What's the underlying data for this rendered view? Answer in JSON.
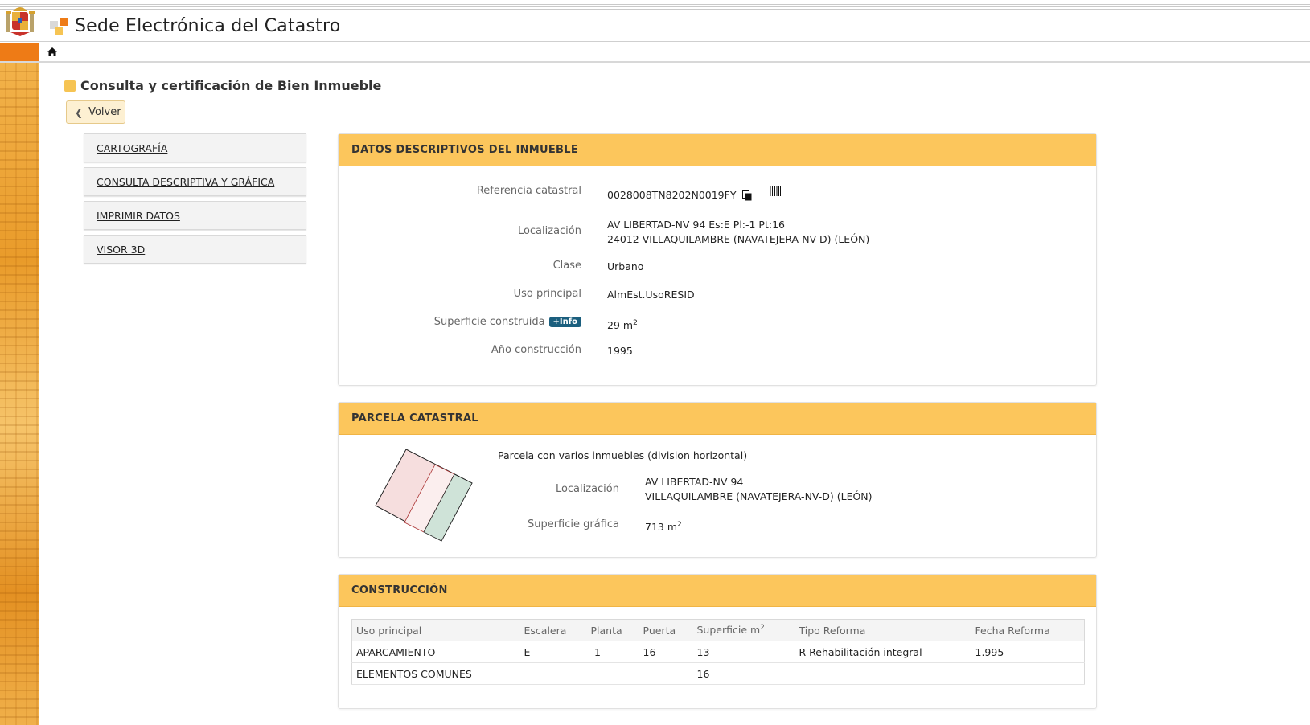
{
  "header": {
    "site_title": "Sede Electrónica del Catastro"
  },
  "page": {
    "title": "Consulta y certificación de Bien Inmueble",
    "back_label": "Volver"
  },
  "menu": {
    "items": [
      {
        "label": "CARTOGRAFÍA"
      },
      {
        "label": "CONSULTA DESCRIPTIVA Y GRÁFICA"
      },
      {
        "label": "IMPRIMIR DATOS"
      },
      {
        "label": "VISOR 3D"
      }
    ]
  },
  "datos": {
    "title": "DATOS DESCRIPTIVOS DEL INMUEBLE",
    "referencia_label": "Referencia catastral",
    "referencia_value": "0028008TN8202N0019FY",
    "localizacion_label": "Localización",
    "localizacion_line1": "AV LIBERTAD-NV 94 Es:E Pl:-1 Pt:16",
    "localizacion_line2": "24012 VILLAQUILAMBRE (NAVATEJERA-NV-D) (LEÓN)",
    "clase_label": "Clase",
    "clase_value": "Urbano",
    "uso_label": "Uso principal",
    "uso_value": "AlmEst.UsoRESID",
    "superficie_label": "Superficie construida",
    "info_badge": "+Info",
    "superficie_value": "29 m",
    "superficie_unit_sup": "2",
    "anio_label": "Año construcción",
    "anio_value": "1995"
  },
  "parcela": {
    "title": "PARCELA CATASTRAL",
    "descripcion": "Parcela con varios inmuebles (division horizontal)",
    "localizacion_label": "Localización",
    "localizacion_line1": "AV LIBERTAD-NV 94",
    "localizacion_line2": "VILLAQUILAMBRE (NAVATEJERA-NV-D) (LEÓN)",
    "superficie_label": "Superficie gráfica",
    "superficie_value": "713 m",
    "superficie_unit_sup": "2"
  },
  "construccion": {
    "title": "CONSTRUCCIÓN",
    "headers": [
      "Uso principal",
      "Escalera",
      "Planta",
      "Puerta",
      "Superficie m",
      "Tipo Reforma",
      "Fecha Reforma"
    ],
    "superficie_header_sup": "2",
    "rows": [
      [
        "APARCAMIENTO",
        "E",
        "-1",
        "16",
        "13",
        "R Rehabilitación integral",
        "1.995"
      ],
      [
        "ELEMENTOS COMUNES",
        "",
        "",
        "",
        "16",
        "",
        ""
      ]
    ]
  },
  "colors": {
    "panel_header": "#fcc65c",
    "nav_accent": "#ee7b16",
    "info_badge": "#1b5f7e"
  }
}
